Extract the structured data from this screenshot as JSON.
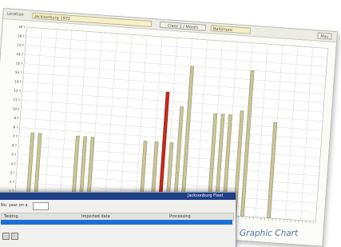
{
  "toolbar": {
    "left_label": "Location",
    "selector_1": "Jacksonburg 1972",
    "middle_button": "Class 1 / Month",
    "selector_2": "Baltimore",
    "right_button": "Max"
  },
  "caption": "Graphic Chart",
  "dialog": {
    "title": "Jacksonburg Fleet",
    "row_label": "No. year on a",
    "header_col_1": "Testing",
    "header_col_2": "Imported data",
    "header_col_3": "Processing"
  },
  "colors": {
    "bar": "#c8c59a",
    "bar_stroke": "#8e8a55",
    "highlight": "#c22b1f",
    "grid": "#cfcfc8",
    "selection": "#1d6fd8"
  },
  "chart_data": {
    "type": "bar",
    "title": "",
    "xlabel": "",
    "ylabel": "",
    "ylim": [
      0,
      19
    ],
    "y_ticks": [
      {
        "value": 19,
        "label": "19 ?"
      },
      {
        "value": 18,
        "label": "18 ?"
      },
      {
        "value": 17,
        "label": "17 ?"
      },
      {
        "value": 16,
        "label": "16 ?"
      },
      {
        "value": 15,
        "label": "15 ?"
      },
      {
        "value": 14,
        "label": "14 ?"
      },
      {
        "value": 13,
        "label": "13 ?"
      },
      {
        "value": 12,
        "label": "12 ?"
      },
      {
        "value": 11,
        "label": "11 ?"
      },
      {
        "value": 10,
        "label": "10 ?"
      },
      {
        "value": 9,
        "label": "9 ?"
      },
      {
        "value": 8,
        "label": "8 ?"
      },
      {
        "value": 7,
        "label": "7 ?"
      },
      {
        "value": 6,
        "label": "6 ?"
      },
      {
        "value": 5,
        "label": "5 ?"
      },
      {
        "value": 4,
        "label": "4 ?"
      },
      {
        "value": 3,
        "label": "3 ?"
      },
      {
        "value": 2,
        "label": "2 ?"
      },
      {
        "value": 1,
        "label": "1 ?"
      }
    ],
    "x_count": 80,
    "grid": true,
    "bars": [
      {
        "x": 3,
        "value": 7.5,
        "highlight": false
      },
      {
        "x": 5,
        "value": 7.5,
        "highlight": false
      },
      {
        "x": 15,
        "value": 7.5,
        "highlight": false
      },
      {
        "x": 17,
        "value": 7.5,
        "highlight": false
      },
      {
        "x": 19,
        "value": 7.5,
        "highlight": false
      },
      {
        "x": 33,
        "value": 7.5,
        "highlight": false
      },
      {
        "x": 36,
        "value": 7.5,
        "highlight": false
      },
      {
        "x": 38,
        "value": 13.0,
        "highlight": true
      },
      {
        "x": 40,
        "value": 7.5,
        "highlight": false
      },
      {
        "x": 42,
        "value": 11.5,
        "highlight": false
      },
      {
        "x": 44,
        "value": 16.0,
        "highlight": false
      },
      {
        "x": 51,
        "value": 11.0,
        "highlight": false
      },
      {
        "x": 53,
        "value": 11.0,
        "highlight": false
      },
      {
        "x": 55,
        "value": 11.0,
        "highlight": false
      },
      {
        "x": 58,
        "value": 11.5,
        "highlight": false
      },
      {
        "x": 60,
        "value": 16.0,
        "highlight": false
      },
      {
        "x": 67,
        "value": 10.5,
        "highlight": false
      }
    ]
  }
}
